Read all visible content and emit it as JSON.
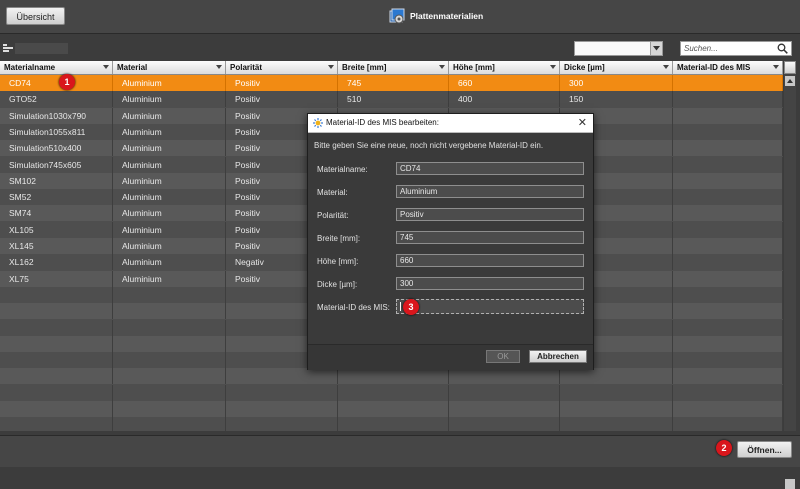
{
  "header": {
    "overview_button": "Übersicht",
    "app_title": "Plattenmaterialien",
    "app_icon": "plate-gear-icon"
  },
  "toolbar": {
    "filter_dropdown_value": "",
    "search_placeholder": "Suchen..."
  },
  "table": {
    "columns": [
      "Materialname",
      "Material",
      "Polarität",
      "Breite [mm]",
      "Höhe [mm]",
      "Dicke [µm]",
      "Material-ID des MIS"
    ],
    "rows": [
      [
        "CD74",
        "Aluminium",
        "Positiv",
        "745",
        "660",
        "300",
        ""
      ],
      [
        "GTO52",
        "Aluminium",
        "Positiv",
        "510",
        "400",
        "150",
        ""
      ],
      [
        "Simulation1030x790",
        "Aluminium",
        "Positiv",
        "",
        "",
        "",
        ""
      ],
      [
        "Simulation1055x811",
        "Aluminium",
        "Positiv",
        "",
        "",
        "",
        ""
      ],
      [
        "Simulation510x400",
        "Aluminium",
        "Positiv",
        "",
        "",
        "",
        ""
      ],
      [
        "Simulation745x605",
        "Aluminium",
        "Positiv",
        "",
        "",
        "",
        ""
      ],
      [
        "SM102",
        "Aluminium",
        "Positiv",
        "",
        "",
        "",
        ""
      ],
      [
        "SM52",
        "Aluminium",
        "Positiv",
        "",
        "",
        "",
        ""
      ],
      [
        "SM74",
        "Aluminium",
        "Positiv",
        "",
        "",
        "",
        ""
      ],
      [
        "XL105",
        "Aluminium",
        "Positiv",
        "",
        "",
        "",
        ""
      ],
      [
        "XL145",
        "Aluminium",
        "Positiv",
        "",
        "",
        "",
        ""
      ],
      [
        "XL162",
        "Aluminium",
        "Negativ",
        "",
        "",
        "",
        ""
      ],
      [
        "XL75",
        "Aluminium",
        "Positiv",
        "",
        "",
        "",
        ""
      ]
    ],
    "selected_row": 0
  },
  "dialog": {
    "title": "Material-ID des MIS bearbeiten:",
    "intro": "Bitte geben Sie eine neue, noch nicht vergebene Material-ID ein.",
    "fields": [
      {
        "label": "Materialname:",
        "value": "CD74"
      },
      {
        "label": "Material:",
        "value": "Aluminium"
      },
      {
        "label": "Polarität:",
        "value": "Positiv"
      },
      {
        "label": "Breite [mm]:",
        "value": "745"
      },
      {
        "label": "Höhe [mm]:",
        "value": "660"
      },
      {
        "label": "Dicke [µm]:",
        "value": "300"
      },
      {
        "label": "Material-ID des MIS:",
        "value": ""
      }
    ],
    "ok_label": "OK",
    "cancel_label": "Abbrechen",
    "close_glyph": "✕"
  },
  "footer": {
    "open_button": "Öffnen..."
  },
  "callouts": [
    "1",
    "2",
    "3"
  ],
  "colors": {
    "selection": "#f28b13",
    "callout": "#d9161c",
    "background": "#3c3c3c"
  }
}
